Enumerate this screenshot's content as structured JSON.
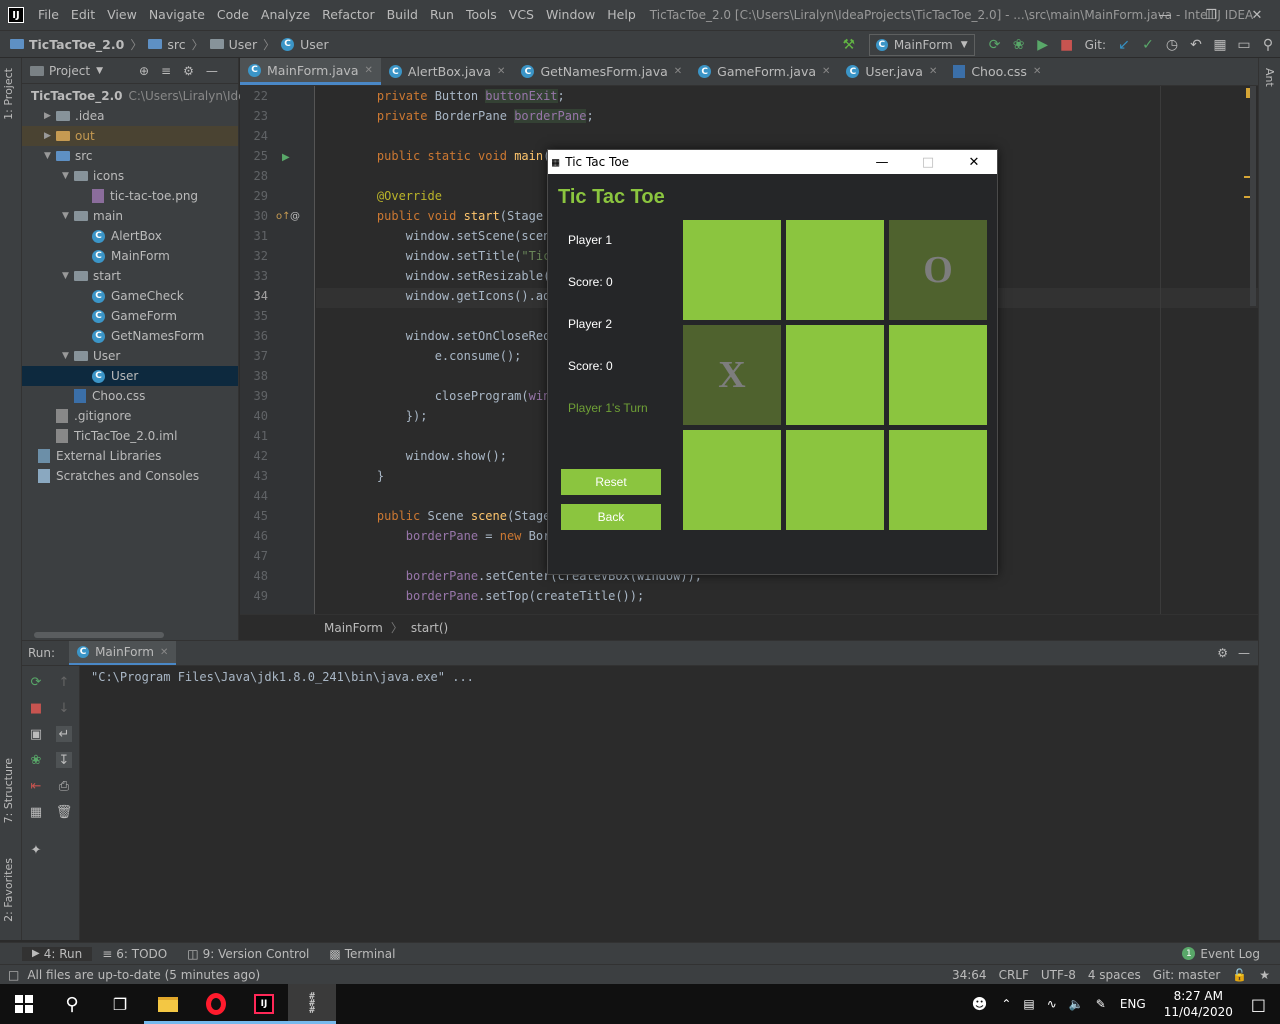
{
  "window": {
    "title": "TicTacToe_2.0 [C:\\Users\\Liralyn\\IdeaProjects\\TicTacToe_2.0] - ...\\src\\main\\MainForm.java - IntelliJ IDEA",
    "menu": [
      "File",
      "Edit",
      "View",
      "Navigate",
      "Code",
      "Analyze",
      "Refactor",
      "Build",
      "Run",
      "Tools",
      "VCS",
      "Window",
      "Help"
    ]
  },
  "navbar": {
    "project": "TicTacToe_2.0",
    "crumbs": [
      "src",
      "User",
      "User"
    ],
    "run_config": "MainForm",
    "git_label": "Git:"
  },
  "project_panel": {
    "title": "Project",
    "tree": [
      {
        "label": "TicTacToe_2.0",
        "extra": "C:\\Users\\Liralyn\\Idea",
        "indent": 0,
        "icon": "folder-blue",
        "bold": true
      },
      {
        "label": ".idea",
        "indent": 1,
        "icon": "folder",
        "collapsed": true
      },
      {
        "label": "out",
        "indent": 1,
        "icon": "folder-orange",
        "collapsed": true,
        "color": "#c59a52"
      },
      {
        "label": "src",
        "indent": 1,
        "icon": "folder-blue",
        "expanded": true
      },
      {
        "label": "icons",
        "indent": 2,
        "icon": "folder",
        "expanded": true
      },
      {
        "label": "tic-tac-toe.png",
        "indent": 3,
        "icon": "image"
      },
      {
        "label": "main",
        "indent": 2,
        "icon": "folder",
        "expanded": true
      },
      {
        "label": "AlertBox",
        "indent": 3,
        "icon": "class"
      },
      {
        "label": "MainForm",
        "indent": 3,
        "icon": "class"
      },
      {
        "label": "start",
        "indent": 2,
        "icon": "folder",
        "expanded": true
      },
      {
        "label": "GameCheck",
        "indent": 3,
        "icon": "class"
      },
      {
        "label": "GameForm",
        "indent": 3,
        "icon": "class"
      },
      {
        "label": "GetNamesForm",
        "indent": 3,
        "icon": "class"
      },
      {
        "label": "User",
        "indent": 2,
        "icon": "folder",
        "expanded": true
      },
      {
        "label": "User",
        "indent": 3,
        "icon": "class",
        "selected": true
      },
      {
        "label": "Choo.css",
        "indent": 2,
        "icon": "css"
      },
      {
        "label": ".gitignore",
        "indent": 1,
        "icon": "file"
      },
      {
        "label": "TicTacToe_2.0.iml",
        "indent": 1,
        "icon": "file"
      },
      {
        "label": "External Libraries",
        "indent": 0,
        "icon": "library"
      },
      {
        "label": "Scratches and Consoles",
        "indent": 0,
        "icon": "scratch"
      }
    ]
  },
  "tabs": [
    {
      "label": "MainForm.java",
      "active": true
    },
    {
      "label": "AlertBox.java"
    },
    {
      "label": "GetNamesForm.java"
    },
    {
      "label": "GameForm.java"
    },
    {
      "label": "User.java"
    },
    {
      "label": "Choo.css"
    }
  ],
  "editor": {
    "lines": [
      {
        "n": "22",
        "html": "    <span class='kw'>private</span> Button <span class='fld hl'>buttonExit</span>;"
      },
      {
        "n": "23",
        "html": "    <span class='kw'>private</span> BorderPane <span class='fld hl'>borderPane</span>;"
      },
      {
        "n": "24",
        "html": ""
      },
      {
        "n": "25",
        "html": "    <span class='kw'>public static void</span> <span class='fn'>main</span>(String[] args) {"
      },
      {
        "n": "28",
        "html": ""
      },
      {
        "n": "29",
        "html": "    <span class='ann'>@Override</span>"
      },
      {
        "n": "30",
        "html": "    <span class='kw'>public void</span> <span class='fn'>start</span>(Stage window) {"
      },
      {
        "n": "31",
        "html": "        window.setScene(scene(window));"
      },
      {
        "n": "32",
        "html": "        window.setTitle(<span class='str'>\"Tic Tac Toe\"</span>);"
      },
      {
        "n": "33",
        "html": "        window.setResizable(<span class='kw'>false</span>);"
      },
      {
        "n": "34",
        "html": "        window.getIcons().add(<span class='kw'>new</span> Image(...));"
      },
      {
        "n": "35",
        "html": ""
      },
      {
        "n": "36",
        "html": "        window.setOnCloseRequest(e -> {"
      },
      {
        "n": "37",
        "html": "            e.consume();"
      },
      {
        "n": "38",
        "html": ""
      },
      {
        "n": "39",
        "html": "            closeProgram(<span class='fld'>window</span>);"
      },
      {
        "n": "40",
        "html": "        });"
      },
      {
        "n": "41",
        "html": ""
      },
      {
        "n": "42",
        "html": "        window.show();"
      },
      {
        "n": "43",
        "html": "    }"
      },
      {
        "n": "44",
        "html": ""
      },
      {
        "n": "45",
        "html": "    <span class='kw'>public</span> Scene <span class='fn'>scene</span>(Stage window) {"
      },
      {
        "n": "46",
        "html": "        <span class='fld'>borderPane</span> = <span class='kw'>new</span> BorderPane();"
      },
      {
        "n": "47",
        "html": ""
      },
      {
        "n": "48",
        "html": "        <span class='fld'>borderPane</span>.setCenter(createVBox(window));"
      },
      {
        "n": "49",
        "html": "        <span class='fld'>borderPane</span>.setTop(createTitle());"
      }
    ],
    "breadcrumb": [
      "MainForm",
      "start()"
    ]
  },
  "run_panel": {
    "label": "Run:",
    "tab": "MainForm",
    "console_line": "\"C:\\Program Files\\Java\\jdk1.8.0_241\\bin\\java.exe\" ..."
  },
  "bottom_tabs": [
    {
      "label": "4: Run",
      "active": true
    },
    {
      "label": "6: TODO"
    },
    {
      "label": "9: Version Control"
    },
    {
      "label": "Terminal"
    }
  ],
  "event_log": "Event Log",
  "event_count": "1",
  "status": {
    "message": "All files are up-to-date (5 minutes ago)",
    "position": "34:64",
    "line_sep": "CRLF",
    "encoding": "UTF-8",
    "indent": "4 spaces",
    "git": "Git: master"
  },
  "left_vtabs": [
    "1: Project",
    "7: Structure",
    "2: Favorites"
  ],
  "right_vtabs": [
    "Ant"
  ],
  "taskbar": {
    "lang": "ENG",
    "time": "8:27 AM",
    "date": "11/04/2020"
  },
  "game": {
    "window_title": "Tic Tac Toe",
    "heading": "Tic Tac Toe",
    "player1": "Player 1",
    "score1": "Score: 0",
    "player2": "Player 2",
    "score2": "Score: 0",
    "turn": "Player 1's Turn",
    "reset": "Reset",
    "back": "Back",
    "board": [
      "",
      "",
      "O",
      "X",
      "",
      "",
      "",
      "",
      ""
    ]
  },
  "colors": {
    "accent_green": "#8bc53f",
    "played_cell": "#4f622e",
    "ide_bg": "#2b2b2b",
    "panel_bg": "#3c3f41"
  }
}
